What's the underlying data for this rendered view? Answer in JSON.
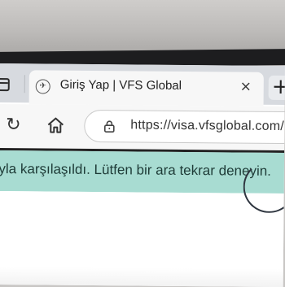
{
  "browser": {
    "tab": {
      "title": "Giriş Yap | VFS Global",
      "favicon": "vfs-favicon-icon",
      "close_glyph": "×"
    },
    "new_tab_glyph": "+",
    "toolbar": {
      "reload_glyph": "↻",
      "home_icon": "home-icon",
      "lock_icon": "lock-icon"
    },
    "address_bar": {
      "url": "https://visa.vfsglobal.com/"
    }
  },
  "page": {
    "alert": {
      "message": "Bir hatayla karşılaşıldı. Lütfen bir ara tekrar deneyin.",
      "background_color": "#a8dcd2"
    }
  }
}
